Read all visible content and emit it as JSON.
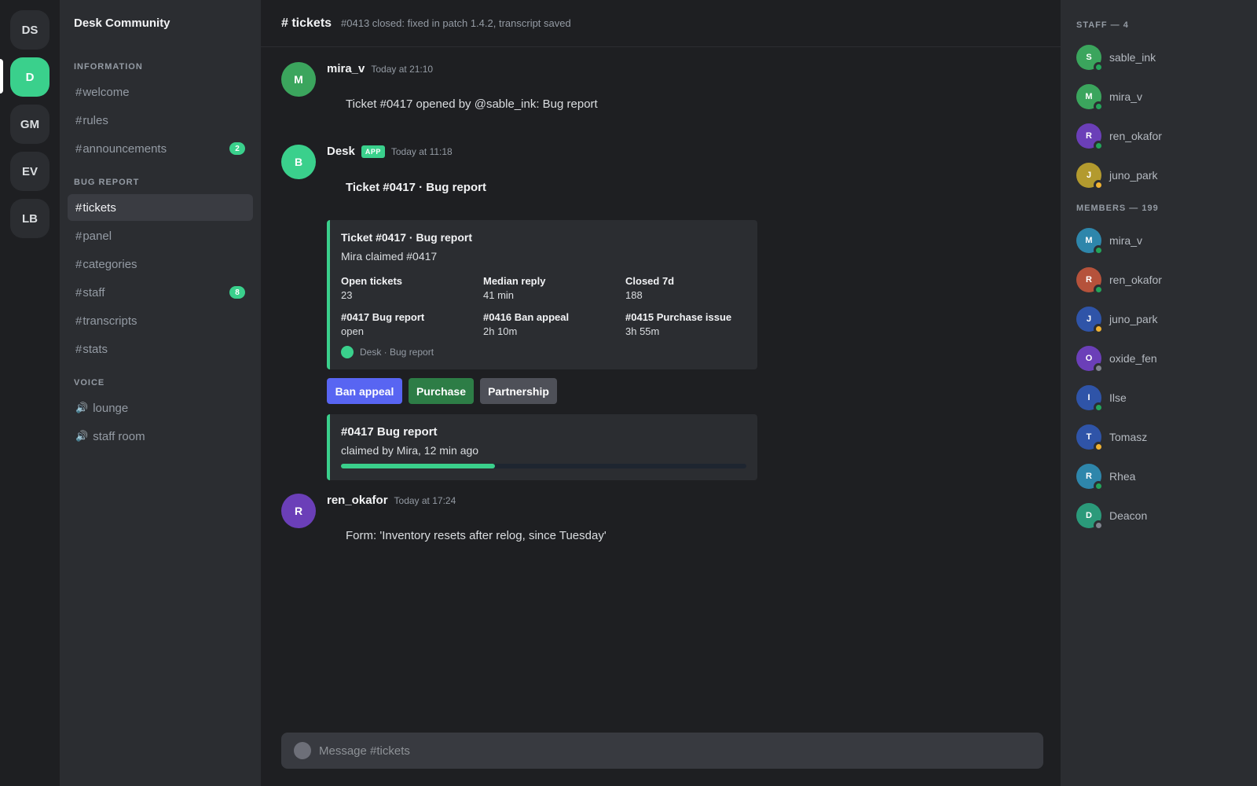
{
  "servers": [
    {
      "label": "DS",
      "active": false
    },
    {
      "label": "D",
      "active": true
    },
    {
      "label": "GM",
      "active": false
    },
    {
      "label": "EV",
      "active": false
    },
    {
      "label": "LB",
      "active": false
    }
  ],
  "sidebar": {
    "guild_name": "Desk Community",
    "categories": [
      {
        "label": "INFORMATION"
      },
      {
        "label": "BUG REPORT"
      },
      {
        "label": "VOICE"
      }
    ],
    "information_channels": [
      {
        "label": "welcome"
      },
      {
        "label": "rules"
      },
      {
        "label": "announcements",
        "badge": "2"
      }
    ],
    "bug_channels": [
      {
        "label": "tickets",
        "active": true
      },
      {
        "label": "panel"
      },
      {
        "label": "categories"
      },
      {
        "label": "staff",
        "badge": "8"
      },
      {
        "label": "transcripts"
      },
      {
        "label": "stats"
      }
    ],
    "voice_channels": [
      {
        "label": "lounge"
      },
      {
        "label": "staff room"
      }
    ]
  },
  "header": {
    "title": "# tickets",
    "topic": "#0413 closed: fixed in patch 1.4.2, transcript saved"
  },
  "messages": [
    {
      "author": "mira_v",
      "initial": "M",
      "avatar_color": "#3ba55d",
      "timestamp": "Today at 21:10",
      "body": "Ticket #0417 opened by @sable_ink: Bug report"
    },
    {
      "author": "Desk",
      "initial": "B",
      "avatar_color": "#3ad08c",
      "tag": "APP",
      "timestamp": "Today at 11:18",
      "body": "Ticket #0417 · Bug report"
    },
    {
      "author": "ren_okafor",
      "initial": "R",
      "avatar_color": "#6b3fb8",
      "timestamp": "Today at 17:24",
      "body": "Form: 'Inventory resets after relog, since Tuesday'"
    }
  ],
  "embed": {
    "title": "Ticket #0417 · Bug report",
    "description": "Mira claimed #0417",
    "fields": [
      {
        "name": "Open tickets",
        "value": "23"
      },
      {
        "name": "Median reply",
        "value": "41 min"
      },
      {
        "name": "Closed 7d",
        "value": "188"
      },
      {
        "name": "#0417 Bug report",
        "value": "open"
      },
      {
        "name": "#0416 Ban appeal",
        "value": "2h 10m"
      },
      {
        "name": "#0415 Purchase issue",
        "value": "3h 55m"
      }
    ],
    "footer": "Desk · Bug report"
  },
  "buttons": [
    {
      "label": "Ban appeal",
      "color": "#5865f2"
    },
    {
      "label": "Purchase",
      "color": "#2d7d46"
    },
    {
      "label": "Partnership",
      "color": "#4e5058"
    }
  ],
  "claim_card": {
    "title": "#0417 Bug report",
    "description": "claimed by Mira, 12 min ago",
    "progress_fraction": 0.38
  },
  "composer": {
    "placeholder": "Message #tickets"
  },
  "members": {
    "staff_header": "STAFF — 4",
    "staff": [
      {
        "name": "sable_ink",
        "initial": "S",
        "color": "#3ba55d",
        "status_color": "#23a55a"
      },
      {
        "name": "mira_v",
        "initial": "M",
        "color": "#3ba55d",
        "status_color": "#23a55a"
      },
      {
        "name": "ren_okafor",
        "initial": "R",
        "color": "#6b3fb8",
        "status_color": "#23a55a"
      },
      {
        "name": "juno_park",
        "initial": "J",
        "color": "#b39a2e",
        "status_color": "#f0b232"
      }
    ],
    "members_header": "MEMBERS — 199",
    "list": [
      {
        "name": "mira_v",
        "initial": "M",
        "color": "#2e86ab",
        "status_color": "#23a55a"
      },
      {
        "name": "ren_okafor",
        "initial": "R",
        "color": "#b5523b",
        "status_color": "#23a55a"
      },
      {
        "name": "juno_park",
        "initial": "J",
        "color": "#2f54a8",
        "status_color": "#f0b232"
      },
      {
        "name": "oxide_fen",
        "initial": "O",
        "color": "#6b3fb8",
        "status_color": "#80848e"
      },
      {
        "name": "Ilse",
        "initial": "I",
        "color": "#2f54a8",
        "status_color": "#23a55a"
      },
      {
        "name": "Tomasz",
        "initial": "T",
        "color": "#2f54a8",
        "status_color": "#f0b232"
      },
      {
        "name": "Rhea",
        "initial": "R",
        "color": "#2e86ab",
        "status_color": "#23a55a"
      },
      {
        "name": "Deacon",
        "initial": "D",
        "color": "#2b9a7a",
        "status_color": "#80848e"
      }
    ]
  }
}
